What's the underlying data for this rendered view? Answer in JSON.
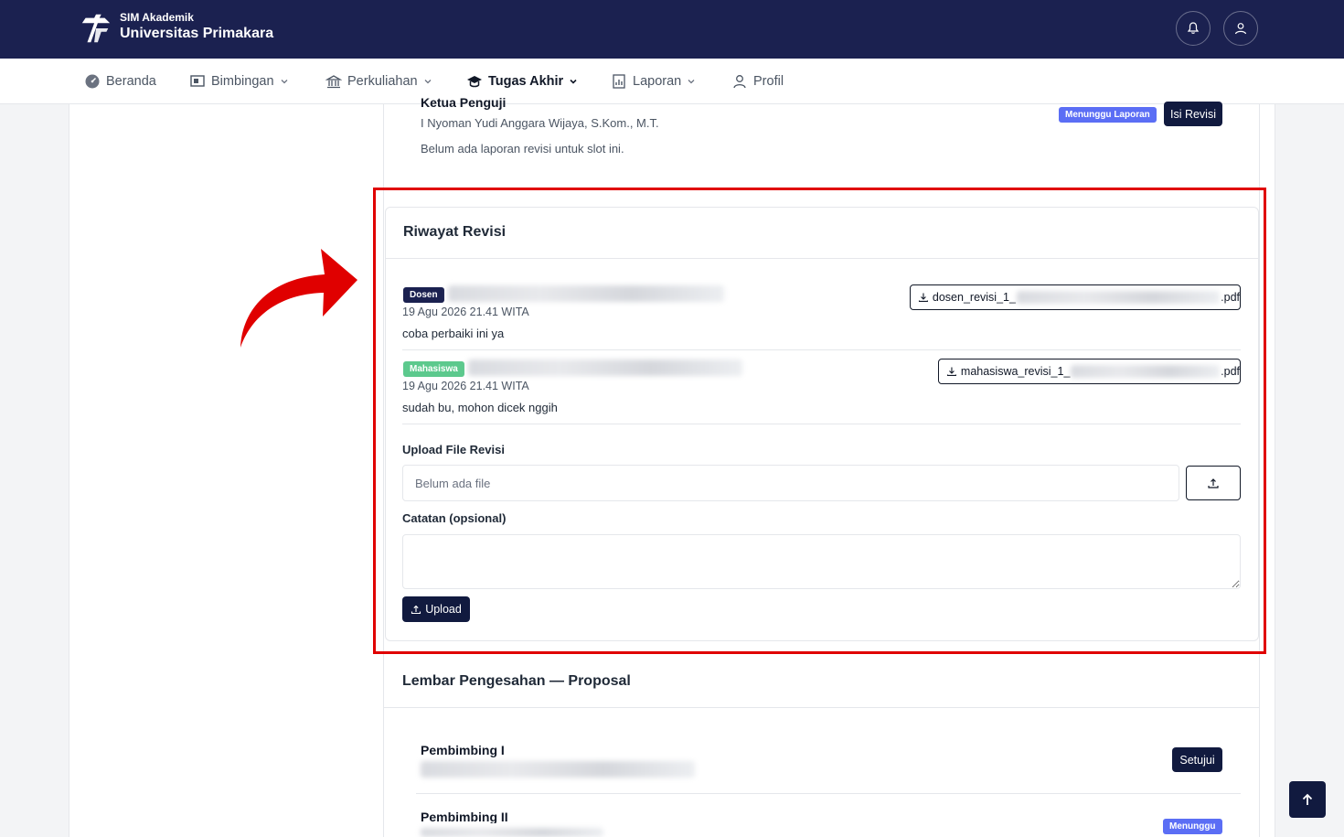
{
  "header": {
    "brand_sub": "SIM Akademik",
    "brand_main": "Universitas Primakara"
  },
  "nav": {
    "items": [
      {
        "label": "Beranda",
        "icon": "dashboard-icon"
      },
      {
        "label": "Bimbingan",
        "icon": "presentation-icon"
      },
      {
        "label": "Perkuliahan",
        "icon": "institution-icon"
      },
      {
        "label": "Tugas Akhir",
        "icon": "graduation-cap-icon"
      },
      {
        "label": "Laporan",
        "icon": "report-icon"
      },
      {
        "label": "Profil",
        "icon": "user-icon"
      }
    ],
    "active": "Tugas Akhir"
  },
  "previous_slot": {
    "title": "Ketua Penguji",
    "name": "I Nyoman Yudi Anggara Wijaya, S.Kom., M.T.",
    "note": "Belum ada laporan revisi untuk slot ini.",
    "status": "Menunggu Laporan",
    "action": "Isi Revisi"
  },
  "revision": {
    "title": "Riwayat Revisi",
    "entries": [
      {
        "role": "Dosen",
        "timestamp": "19 Agu 2026 21.41 WITA",
        "message": "coba perbaiki ini ya",
        "file_prefix": "dosen_revisi_1_",
        "file_suffix": ".pdf"
      },
      {
        "role": "Mahasiswa",
        "timestamp": "19 Agu 2026 21.41 WITA",
        "message": "sudah bu, mohon dicek nggih",
        "file_prefix": "mahasiswa_revisi_1_",
        "file_suffix": ".pdf"
      }
    ],
    "upload_label": "Upload File Revisi",
    "file_placeholder": "Belum ada file",
    "notes_label": "Catatan (opsional)",
    "notes_value": "",
    "upload_button": "Upload"
  },
  "approval": {
    "title": "Lembar Pengesahan — Proposal",
    "rows": [
      {
        "role": "Pembimbing I",
        "action": "Setujui"
      },
      {
        "role": "Pembimbing II",
        "status": "Menunggu"
      }
    ]
  },
  "colors": {
    "navy": "#1b2150",
    "highlight_red": "#e00000",
    "badge_blue": "#5b6ef5",
    "badge_green": "#5cc98d"
  }
}
